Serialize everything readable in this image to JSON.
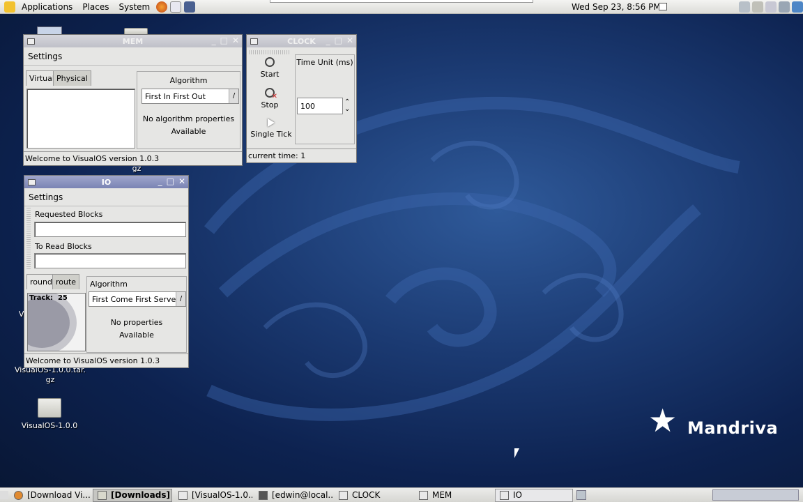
{
  "top_panel": {
    "menus": [
      "Applications",
      "Places",
      "System"
    ],
    "datetime": "Wed Sep 23,  8:56 PM"
  },
  "desktop": {
    "icons": [
      {
        "label": "gz"
      },
      {
        "label": "Vi"
      },
      {
        "label_line1": "VisualOS-1.0.0.tar.",
        "label_line2": "gz"
      },
      {
        "label": "VisualOS-1.0.0"
      }
    ],
    "logo": "Mandriva",
    "logo_star": "★"
  },
  "mem": {
    "title": "MEM",
    "menu": "Settings",
    "tabs": [
      "Virtual",
      "Physical"
    ],
    "algorithm_label": "Algorithm",
    "algorithm_value": "First In First Out",
    "combo_arrow": "/",
    "props_line1": "No algorithm properties",
    "props_line2": "Available",
    "status": "Welcome to VisualOS version 1.0.3"
  },
  "clock": {
    "title": "CLOCK",
    "start": "Start",
    "stop": "Stop",
    "single_tick": "Single Tick",
    "time_unit_label": "Time Unit (ms)",
    "time_unit_value": "100",
    "spin_arrows": "⌃⌄",
    "status": "current time: 1"
  },
  "io": {
    "title": "IO",
    "menu": "Settings",
    "requested_label": "Requested Blocks",
    "to_read_label": "To Read Blocks",
    "tabs": [
      "round",
      "route"
    ],
    "track_label": "Track:  25",
    "algorithm_label": "Algorithm",
    "algorithm_value": "First Come First Served",
    "combo_arrow": "/",
    "props_line1": "No properties",
    "props_line2": "Available",
    "status": "Welcome to VisualOS version 1.0.3",
    "window_buttons": [
      "_",
      "□",
      "✕"
    ]
  },
  "taskbar": {
    "items": [
      "[Download Vi...",
      "[Downloads]",
      "[VisualOS-1.0...",
      "[edwin@local...",
      "CLOCK",
      "MEM",
      "IO"
    ]
  }
}
